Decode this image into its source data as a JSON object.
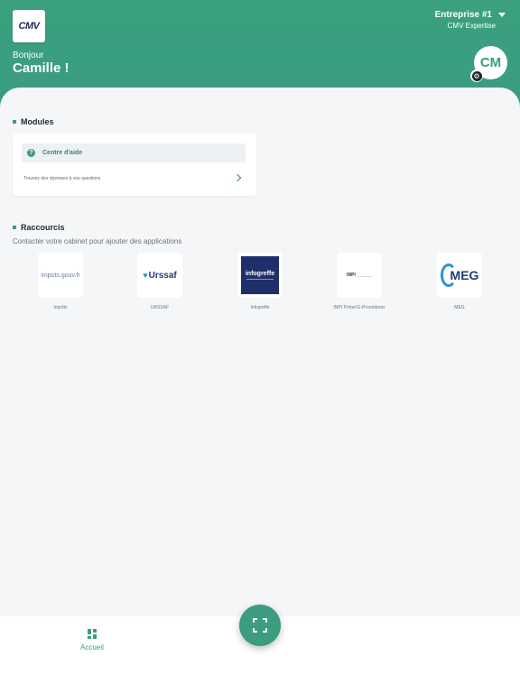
{
  "header": {
    "logo_text": "CMV",
    "greeting": "Bonjour",
    "user_name": "Camille !",
    "company_name": "Entreprise #1",
    "company_sub": "CMV Expertise",
    "avatar_initials": "CM",
    "color_primary": "#3b9c80"
  },
  "modules": {
    "title": "Modules",
    "card": {
      "title": "Centre d'aide",
      "description": "Trouvez des réponses à vos questions",
      "icon": "help-circle-icon"
    }
  },
  "shortcuts": {
    "title": "Raccourcis",
    "subtitle": "Contacter votre cabinet pour ajouter des applications",
    "items": [
      {
        "label": "Impôts",
        "logo_text": "impots.gouv.fr"
      },
      {
        "label": "URSSAF",
        "logo_text": "Urssaf"
      },
      {
        "label": "Infogreffe",
        "logo_text": "infogreffe"
      },
      {
        "label": "INPI Portail E-Procédures",
        "logo_text": "INPI"
      },
      {
        "label": "MEG",
        "logo_text": "MEG"
      }
    ]
  },
  "tabbar": {
    "home_label": "Accueil",
    "scan_icon": "scan-frame-icon"
  }
}
